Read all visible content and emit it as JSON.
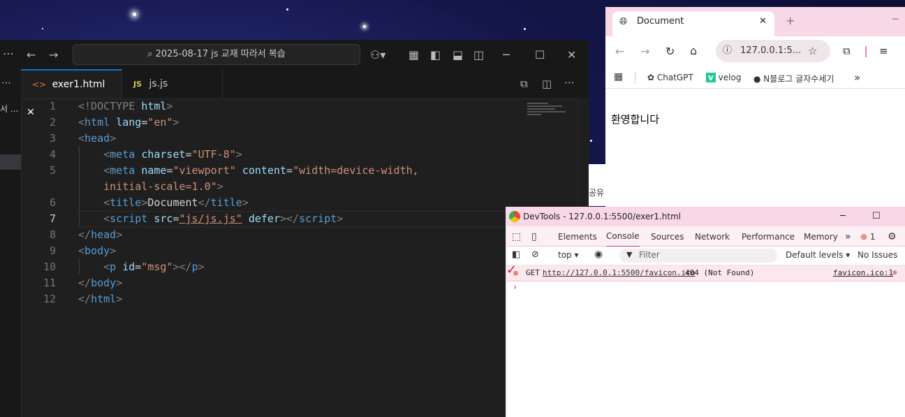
{
  "vscode": {
    "search_text": "2025-08-17 js 교재 따라서 복습",
    "tabs": [
      {
        "label": "exer1.html",
        "close": "✕"
      },
      {
        "label": "js.js",
        "prefix": "JS"
      }
    ],
    "side_text": "서 ...",
    "code_lines": [
      {
        "num": "1"
      },
      {
        "num": "2"
      },
      {
        "num": "3"
      },
      {
        "num": "4"
      },
      {
        "num": "5"
      },
      {
        "num": "6"
      },
      {
        "num": "7"
      },
      {
        "num": "8"
      },
      {
        "num": "9"
      },
      {
        "num": "10"
      },
      {
        "num": "11"
      },
      {
        "num": "12"
      }
    ],
    "strs": {
      "doctype": "<!DOCTYPE",
      "html": "html",
      "lang": "lang",
      "en": "\"en\"",
      "head": "head",
      "meta": "meta",
      "charset": "charset",
      "utf8": "\"UTF-8\"",
      "name": "name",
      "viewport": "\"viewport\"",
      "content": "content",
      "contentval": "\"width=device-width,",
      "contentval2": "initial-scale=1.0\"",
      "title": "title",
      "doctitle": "Document",
      "script": "script",
      "src": "src",
      "srcval": "\"js/js.js\"",
      "defer": "defer",
      "body": "body",
      "p": "p",
      "id": "id",
      "msg": "\"msg\""
    },
    "partial_text": "공유"
  },
  "browser": {
    "tab_title": "Document",
    "url": "127.0.0.1:5...",
    "bookmarks": [
      "ChatGPT",
      "velog",
      "N블로그 글자수세기"
    ],
    "page_text": "환영합니다"
  },
  "devtools": {
    "title": "DevTools - 127.0.0.1:5500/exer1.html",
    "tabs": [
      "Elements",
      "Console",
      "Sources",
      "Network",
      "Performance",
      "Memory"
    ],
    "error_count": "1",
    "context": "top",
    "filter_placeholder": "Filter",
    "levels": "Default levels",
    "issues": "No Issues",
    "error": {
      "method": "GET",
      "url": "http://127.0.0.1:5500/favicon.ico",
      "status": "404 (Not Found)",
      "source": "favicon.ico:1"
    }
  }
}
